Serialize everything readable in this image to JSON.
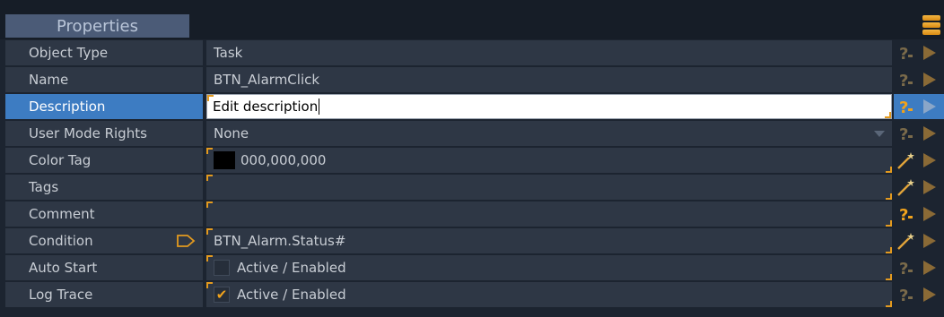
{
  "header": {
    "title": "Properties"
  },
  "colors": {
    "accent": "#f0a21c",
    "selected": "#3d7cc2",
    "cell": "#2e3745",
    "background": "#1c2430"
  },
  "rows": [
    {
      "name": "Object Type",
      "value": "Task",
      "action": "help-icon"
    },
    {
      "name": "Name",
      "value": "BTN_AlarmClick",
      "action": "help-icon"
    },
    {
      "name": "Description",
      "value": "Edit description",
      "action": "help-icon",
      "selected": true
    },
    {
      "name": "User Mode Rights",
      "value": "None",
      "action": "help-icon",
      "control": "dropdown"
    },
    {
      "name": "Color Tag",
      "value": "000,000,000",
      "action": "wand-icon",
      "swatch": "#000000"
    },
    {
      "name": "Tags",
      "value": "",
      "action": "wand-icon"
    },
    {
      "name": "Comment",
      "value": "",
      "action": "help-icon"
    },
    {
      "name": "Condition",
      "value": "BTN_Alarm.Status#",
      "action": "wand-icon",
      "name_icon": "tag-icon"
    },
    {
      "name": "Auto Start",
      "value": "Active / Enabled",
      "action": "help-icon",
      "checked": false
    },
    {
      "name": "Log Trace",
      "value": "Active / Enabled",
      "action": "help-icon",
      "checked": true
    }
  ]
}
